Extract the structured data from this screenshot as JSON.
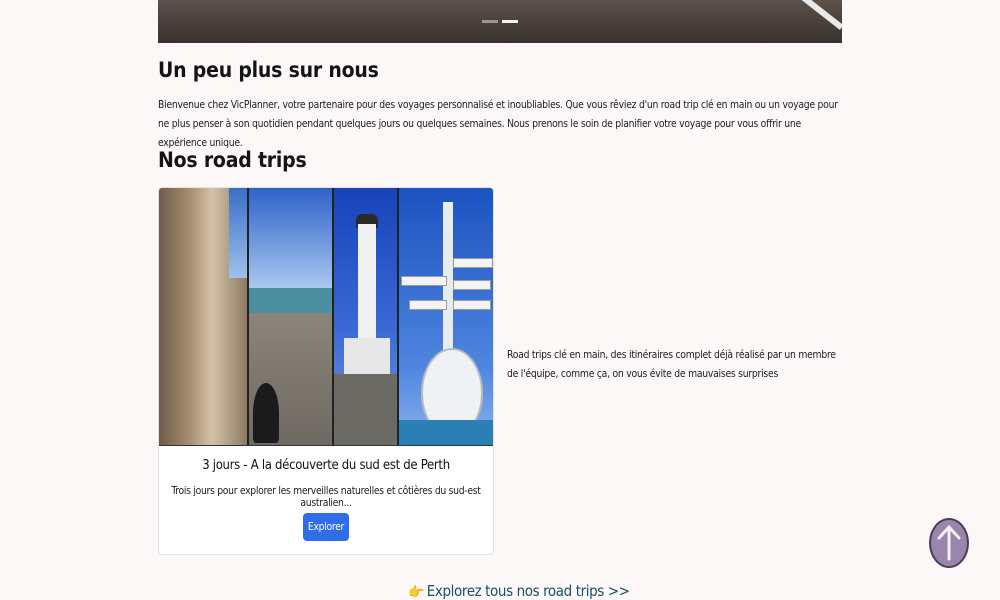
{
  "hero": {
    "carousel_slides": 2,
    "active_slide": 2
  },
  "about": {
    "title": "Un peu plus sur nous",
    "text": "Bienvenue chez VicPlanner, votre partenaire pour des voyages personnalisé et inoubliables. Que vous rêviez d'un road trip clé en main ou un voyage pour ne plus penser à son quotidien pendant quelques jours ou quelques semaines. Nous prenons le soin de planifier votre voyage pour vous offrir une expérience unique."
  },
  "road_trips": {
    "title": "Nos road trips",
    "card": {
      "title": "3 jours - A la découverte du sud est de Perth",
      "description": "Trois jours pour explorer les merveilles naturelles et côtières du sud-est australien...",
      "button_label": "Explorer"
    },
    "side_text": "Road trips clé en main, des itinéraires complet déjà réalisé par un membre de l'équipe, comme ça, on vous évite de mauvaises surprises",
    "all_link_icon": "👉",
    "all_link_label": "Explorez tous nos road trips >>"
  },
  "scroll_top": {
    "icon": "arrow-up-icon"
  },
  "colors": {
    "page_background": "#fdf8f8",
    "button_blue": "#2f6ee8",
    "link_teal": "#17526a",
    "scroll_button": "#9a86ad"
  }
}
